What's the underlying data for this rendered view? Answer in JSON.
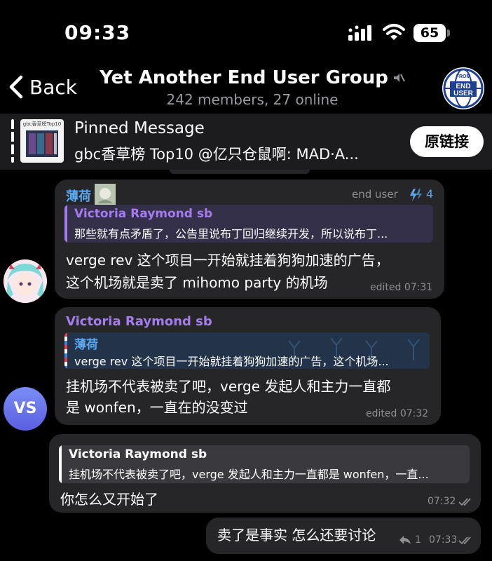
{
  "status_bar": {
    "time": "09:33",
    "battery": "65"
  },
  "header": {
    "back_label": "Back",
    "title": "Yet Another End User Group",
    "subtitle": "242 members, 27 online",
    "group_avatar_top": "FROM",
    "group_avatar_line1": "END",
    "group_avatar_line2": "USER"
  },
  "pinned": {
    "title": "Pinned Message",
    "text": "gbc香草榜 Top10 @亿只仓鼠啊: MAD·A...",
    "thumb_caption": "gbc香草榜Top10",
    "button_label": "原链接"
  },
  "messages": [
    {
      "sender": "薄荷",
      "title": "end user",
      "reactions": "4",
      "quote_name": "Victoria Raymond sb",
      "quote_text": "那些就有点矛盾了，公告里说布丁回归继续开发，所以说布丁...",
      "text_line1": "verge rev 这个项目一开始就挂着狗狗加速的广告，",
      "text_line2": "这个机场就是卖了 mihomo party 的机场",
      "time": "edited 07:31"
    },
    {
      "sender": "Victoria Raymond sb",
      "avatar_initials": "VS",
      "quote_name": "薄荷",
      "quote_text": "verge rev 这个项目一开始就挂着狗狗加速的广告，这个机场...",
      "text_line1": "挂机场不代表被卖了吧，verge 发起人和主力一直都",
      "text_line2": "是 wonfen，一直在的没变过",
      "time": "edited 07:32"
    },
    {
      "quote_name": "Victoria Raymond sb",
      "quote_text": "挂机场不代表被卖了吧，verge 发起人和主力一直都是 wonfen，一直...",
      "text": "你怎么又开始了",
      "time": "07:32"
    },
    {
      "text": "卖了是事实 怎么还要讨论",
      "reply_count": "1",
      "time": "07:33"
    }
  ],
  "colors": {
    "bubble": "#262628",
    "name_blue": "#5aa8f0",
    "name_purple": "#a47cf0",
    "meta": "#8e8e93"
  }
}
